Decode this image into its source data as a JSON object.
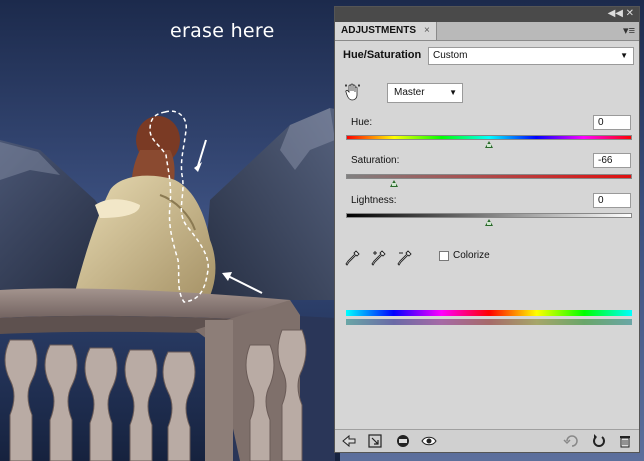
{
  "canvas": {
    "caption": "erase here"
  },
  "panel": {
    "tab_title": "ADJUSTMENTS",
    "tab_close": "×",
    "adjustment_name": "Hue/Saturation",
    "preset_value": "Custom",
    "channel_value": "Master",
    "sliders": {
      "hue": {
        "label": "Hue:",
        "value": "0",
        "level": 0
      },
      "saturation": {
        "label": "Saturation:",
        "value": "-66",
        "level": -66
      },
      "lightness": {
        "label": "Lightness:",
        "value": "0",
        "level": 0
      }
    },
    "colorize_label": "Colorize",
    "colorize_checked": false
  },
  "icons": [
    "collapse-icon",
    "panel-menu-icon",
    "hand-adjust-icon",
    "eyedropper-icon",
    "eyedropper-plus-icon",
    "eyedropper-minus-icon",
    "back-arrow-icon",
    "clip-layer-icon",
    "layer-mask-icon",
    "visibility-eye-icon",
    "previous-state-icon",
    "reset-icon",
    "trash-icon"
  ],
  "colors": {
    "panel_bg": "#d6d6d6",
    "thumb": "#2a6a2a",
    "caption": "#ffffff"
  }
}
